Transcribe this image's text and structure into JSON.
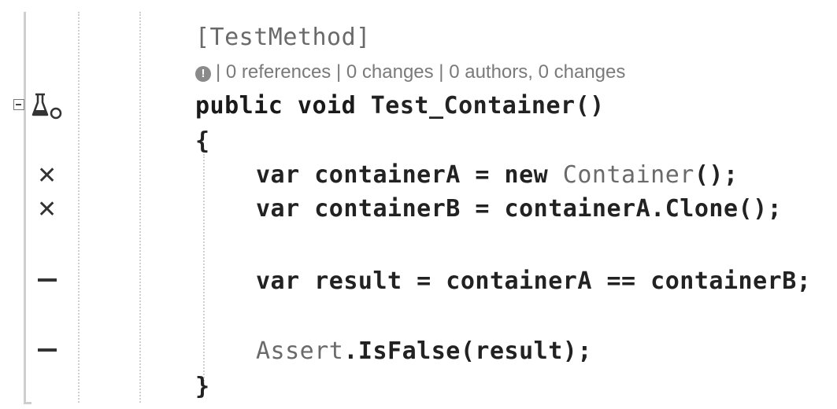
{
  "code": {
    "attribute": "[TestMethod]",
    "codelens": "| 0 references | 0 changes | 0 authors, 0 changes",
    "codelens_icon_label": "!",
    "signature": {
      "keywords": "public void",
      "name": " Test_Container()"
    },
    "open_brace": "{",
    "line1": {
      "prefix": "var containerA = new ",
      "type": "Container",
      "suffix": "();"
    },
    "line2": "var containerB = containerA.Clone();",
    "line3": "var result = containerA == containerB;",
    "line4": {
      "type": "Assert",
      "suffix": ".IsFalse(result);"
    },
    "close_brace": "}"
  },
  "gutter": {
    "markers": [
      {
        "icon": "x-icon",
        "symbol": "✕",
        "status": "failed"
      },
      {
        "icon": "x-icon",
        "symbol": "✕",
        "status": "failed"
      },
      {
        "icon": "dash-icon",
        "status": "not-run"
      },
      {
        "icon": "dash-icon",
        "status": "not-run"
      }
    ],
    "collapse_icon": "collapse-minus-icon",
    "test_icon": "test-flask-icon"
  }
}
